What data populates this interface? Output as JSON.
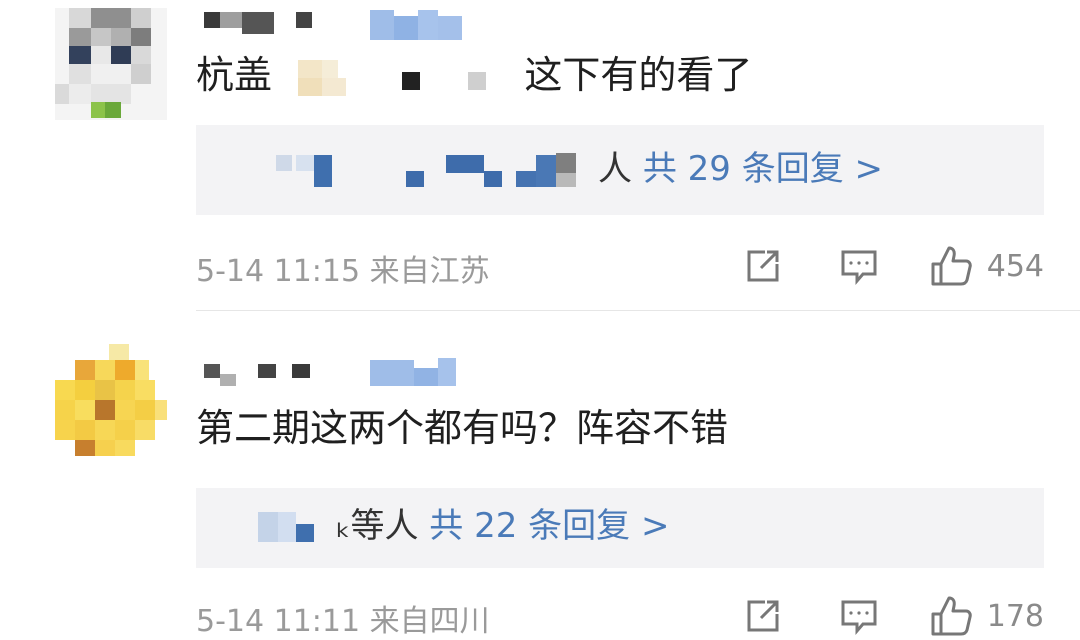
{
  "comments": [
    {
      "text_before": "杭盖",
      "text_after": "这下有的看了",
      "reply_suffix": "人",
      "reply_count_text": "共 29 条回复 >",
      "meta": "5-14 11:15 来自江苏",
      "like_count": "454"
    },
    {
      "text": "第二期这两个都有吗？阵容不错",
      "reply_suffix": "ₖ等人",
      "reply_count_text": "共 22 条回复 >",
      "meta": "5-14 11:11 来自四川",
      "like_count": "178"
    }
  ],
  "colors": {
    "link_blue": "#4a7ab8",
    "reply_bg": "#f3f3f5",
    "meta_gray": "#9a9a9a"
  },
  "icons": [
    "share-icon",
    "comment-icon",
    "thumbs-up-icon"
  ]
}
